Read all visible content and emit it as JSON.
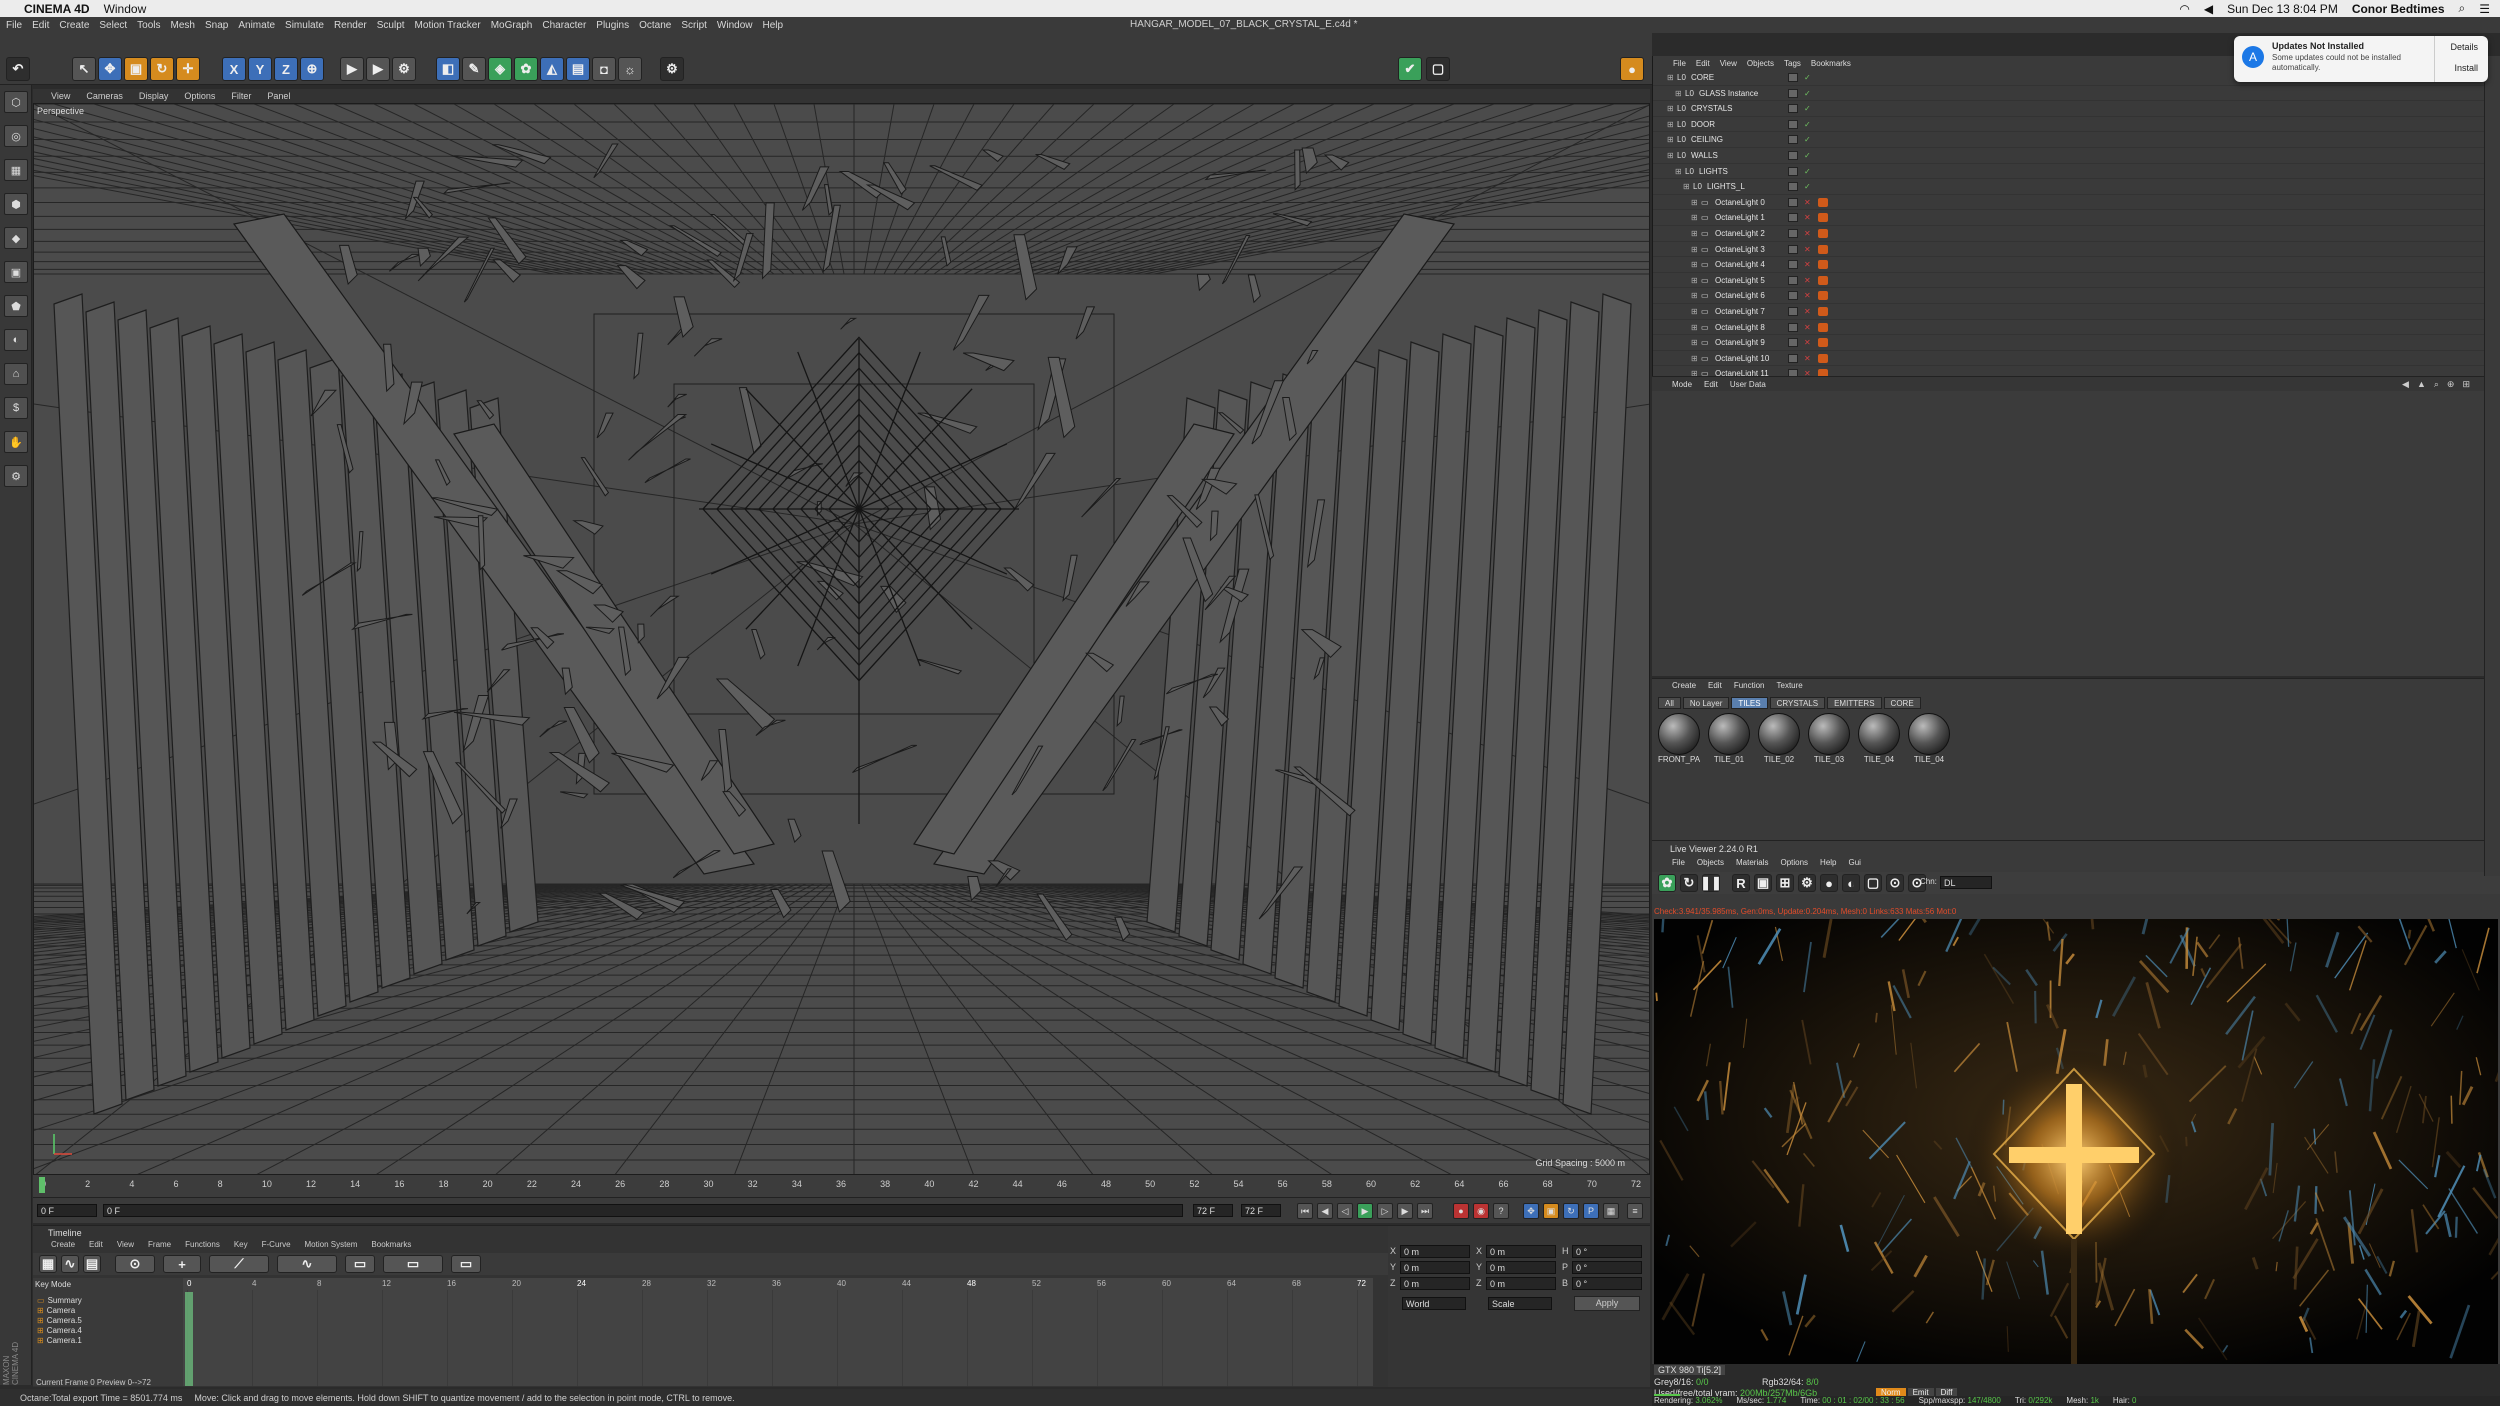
{
  "mac": {
    "menu": [
      "CINEMA 4D",
      "Window"
    ],
    "datetime": "Sun Dec 13  8:04 PM",
    "user": "Conor Bedtimes"
  },
  "c4d": {
    "menus": [
      "File",
      "Edit",
      "Create",
      "Select",
      "Tools",
      "Mesh",
      "Snap",
      "Animate",
      "Simulate",
      "Render",
      "Sculpt",
      "Motion Tracker",
      "MoGraph",
      "Character",
      "Plugins",
      "Octane",
      "Script",
      "Window",
      "Help"
    ],
    "doc_title": "HANGAR_MODEL_07_BLACK_CRYSTAL_E.c4d *"
  },
  "viewport": {
    "menu": [
      "View",
      "Cameras",
      "Display",
      "Options",
      "Filter",
      "Panel"
    ],
    "label": "Perspective",
    "grid_spacing": "Grid Spacing : 5000 m"
  },
  "ruler_ticks": [
    "0",
    "2",
    "4",
    "6",
    "8",
    "10",
    "12",
    "14",
    "16",
    "18",
    "20",
    "22",
    "24",
    "26",
    "28",
    "30",
    "32",
    "34",
    "36",
    "38",
    "40",
    "42",
    "44",
    "46",
    "48",
    "50",
    "52",
    "54",
    "56",
    "58",
    "60",
    "62",
    "64",
    "66",
    "68",
    "70",
    "72"
  ],
  "playbar": {
    "start": "0 F",
    "current": "0 F",
    "end_field": "72 F",
    "end2": "72 F",
    "right_field": "0 F"
  },
  "timeline": {
    "title": "Timeline",
    "menu": [
      "Create",
      "Edit",
      "View",
      "Frame",
      "Functions",
      "Key",
      "F-Curve",
      "Motion System",
      "Bookmarks"
    ],
    "mode": "Key Mode",
    "rows": [
      "Summary",
      "Camera",
      "Camera.5",
      "Camera.4",
      "Camera.1"
    ],
    "grid_ticks": [
      "0",
      "4",
      "8",
      "12",
      "16",
      "20",
      "24",
      "28",
      "32",
      "36",
      "40",
      "44",
      "48",
      "52",
      "56",
      "60",
      "64",
      "68",
      "72"
    ],
    "footer": "Current Frame  0   Preview  0-->72"
  },
  "coords": {
    "rows": [
      {
        "a": "X",
        "av": "0 m",
        "b": "X",
        "bv": "0 m",
        "c": "H",
        "cv": "0 °"
      },
      {
        "a": "Y",
        "av": "0 m",
        "b": "Y",
        "bv": "0 m",
        "c": "P",
        "cv": "0 °"
      },
      {
        "a": "Z",
        "av": "0 m",
        "b": "Z",
        "bv": "0 m",
        "c": "B",
        "cv": "0 °"
      }
    ],
    "world": "World",
    "scale": "Scale",
    "apply": "Apply"
  },
  "status": {
    "octane": "Octane:Total export Time = 8501.774 ms",
    "hint": "Move: Click and drag to move elements. Hold down SHIFT to quantize movement / add to the selection in point mode, CTRL to remove."
  },
  "objects": {
    "menu": [
      "File",
      "Edit",
      "View",
      "Objects",
      "Tags",
      "Bookmarks"
    ],
    "rows": [
      {
        "name": "CORE",
        "indent": 1
      },
      {
        "name": "GLASS Instance",
        "indent": 2
      },
      {
        "name": "CRYSTALS",
        "indent": 1
      },
      {
        "name": "DOOR",
        "indent": 1
      },
      {
        "name": "CEILING",
        "indent": 1
      },
      {
        "name": "WALLS",
        "indent": 1
      },
      {
        "name": "LIGHTS",
        "indent": 2
      },
      {
        "name": "LIGHTS_L",
        "indent": 3
      },
      {
        "name": "OctaneLight 0",
        "indent": 4
      },
      {
        "name": "OctaneLight 1",
        "indent": 4
      },
      {
        "name": "OctaneLight 2",
        "indent": 4
      },
      {
        "name": "OctaneLight 3",
        "indent": 4
      },
      {
        "name": "OctaneLight 4",
        "indent": 4
      },
      {
        "name": "OctaneLight 5",
        "indent": 4
      },
      {
        "name": "OctaneLight 6",
        "indent": 4
      },
      {
        "name": "OctaneLight 7",
        "indent": 4
      },
      {
        "name": "OctaneLight 8",
        "indent": 4
      },
      {
        "name": "OctaneLight 9",
        "indent": 4
      },
      {
        "name": "OctaneLight 10",
        "indent": 4
      },
      {
        "name": "OctaneLight 11",
        "indent": 4
      }
    ]
  },
  "attributes": {
    "menu": [
      "Mode",
      "Edit",
      "User Data"
    ]
  },
  "materials": {
    "menu": [
      "Create",
      "Edit",
      "Function",
      "Texture"
    ],
    "tabs": [
      "All",
      "No Layer",
      "TILES",
      "CRYSTALS",
      "EMITTERS",
      "CORE"
    ],
    "active_tab": "TILES",
    "items": [
      "FRONT_PA",
      "TILE_01",
      "TILE_02",
      "TILE_03",
      "TILE_04",
      "TILE_04"
    ]
  },
  "live_viewer": {
    "title": "Live Viewer 2.24.0 R1",
    "menu": [
      "File",
      "Objects",
      "Materials",
      "Options",
      "Help",
      "Gui"
    ],
    "chn_label": "Chn:",
    "chn_value": "DL",
    "info": "Check:3.941/35.985ms, Gen:0ms, Update:0.204ms, Mesh:0 Links:633 Mats:56 Mot:0",
    "gpu": "GTX 980 Ti[5.2]",
    "grey": "Grey8/16:",
    "grey_v": "0/0",
    "rgb": "Rgb32/64:",
    "rgb_v": "8/0",
    "vram": "Used/free/total vram:",
    "vram_v": "200Mb/257Mb/6Gb",
    "modes": [
      "Norm",
      "Emit",
      "Diff"
    ],
    "rendering": "Rendering:",
    "rendering_v": "3.062%",
    "mssec": "Ms/sec:",
    "mssec_v": "1.774",
    "time": "Time:",
    "time_v": "00 : 01 : 02/00 : 33 : 56",
    "spp": "Spp/maxspp:",
    "spp_v": "147/4800",
    "tri": "Tri:",
    "tri_v": "0/292k",
    "mesh": "Mesh:",
    "mesh_v": "1k",
    "hair": "Hair:",
    "hair_v": "0"
  },
  "notification": {
    "title": "Updates Not Installed",
    "message": "Some updates could not be installed automatically.",
    "details": "Details",
    "install": "Install"
  },
  "left_palette": [
    "⬡",
    "◎",
    "▦",
    "⬢",
    "◆",
    "▣",
    "⬟",
    "◐",
    "⌂",
    "$",
    "✋",
    "⚙"
  ],
  "side_brand": "MAXON CINEMA 4D"
}
